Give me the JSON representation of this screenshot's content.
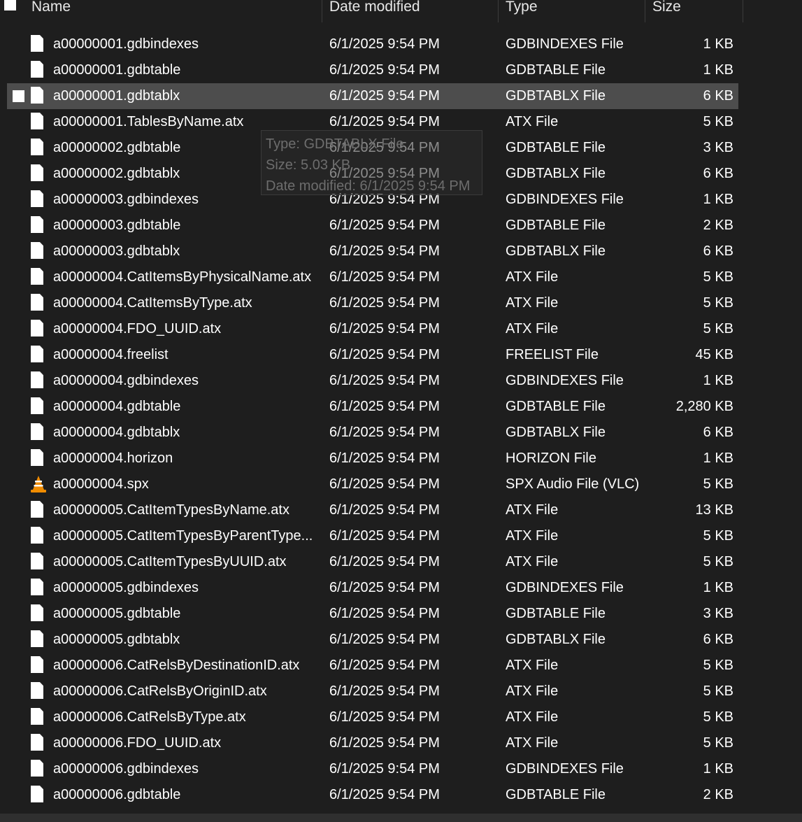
{
  "columns": {
    "name": "Name",
    "date": "Date modified",
    "type": "Type",
    "size": "Size"
  },
  "files": [
    {
      "name": "a00000001.gdbindexes",
      "date": "6/1/2025 9:54 PM",
      "type": "GDBINDEXES File",
      "size": "1 KB",
      "icon": "file-icon"
    },
    {
      "name": "a00000001.gdbtable",
      "date": "6/1/2025 9:54 PM",
      "type": "GDBTABLE File",
      "size": "1 KB",
      "icon": "file-icon"
    },
    {
      "name": "a00000001.gdbtablx",
      "date": "6/1/2025 9:54 PM",
      "type": "GDBTABLX File",
      "size": "6 KB",
      "icon": "file-icon",
      "selected": true
    },
    {
      "name": "a00000001.TablesByName.atx",
      "date": "6/1/2025 9:54 PM",
      "type": "ATX File",
      "size": "5 KB",
      "icon": "file-icon"
    },
    {
      "name": "a00000002.gdbtable",
      "date": "6/1/2025 9:54 PM",
      "type": "GDBTABLE File",
      "size": "3 KB",
      "icon": "file-icon"
    },
    {
      "name": "a00000002.gdbtablx",
      "date": "6/1/2025 9:54 PM",
      "type": "GDBTABLX File",
      "size": "6 KB",
      "icon": "file-icon"
    },
    {
      "name": "a00000003.gdbindexes",
      "date": "6/1/2025 9:54 PM",
      "type": "GDBINDEXES File",
      "size": "1 KB",
      "icon": "file-icon"
    },
    {
      "name": "a00000003.gdbtable",
      "date": "6/1/2025 9:54 PM",
      "type": "GDBTABLE File",
      "size": "2 KB",
      "icon": "file-icon"
    },
    {
      "name": "a00000003.gdbtablx",
      "date": "6/1/2025 9:54 PM",
      "type": "GDBTABLX File",
      "size": "6 KB",
      "icon": "file-icon"
    },
    {
      "name": "a00000004.CatItemsByPhysicalName.atx",
      "date": "6/1/2025 9:54 PM",
      "type": "ATX File",
      "size": "5 KB",
      "icon": "file-icon"
    },
    {
      "name": "a00000004.CatItemsByType.atx",
      "date": "6/1/2025 9:54 PM",
      "type": "ATX File",
      "size": "5 KB",
      "icon": "file-icon"
    },
    {
      "name": "a00000004.FDO_UUID.atx",
      "date": "6/1/2025 9:54 PM",
      "type": "ATX File",
      "size": "5 KB",
      "icon": "file-icon"
    },
    {
      "name": "a00000004.freelist",
      "date": "6/1/2025 9:54 PM",
      "type": "FREELIST File",
      "size": "45 KB",
      "icon": "file-icon"
    },
    {
      "name": "a00000004.gdbindexes",
      "date": "6/1/2025 9:54 PM",
      "type": "GDBINDEXES File",
      "size": "1 KB",
      "icon": "file-icon"
    },
    {
      "name": "a00000004.gdbtable",
      "date": "6/1/2025 9:54 PM",
      "type": "GDBTABLE File",
      "size": "2,280 KB",
      "icon": "file-icon"
    },
    {
      "name": "a00000004.gdbtablx",
      "date": "6/1/2025 9:54 PM",
      "type": "GDBTABLX File",
      "size": "6 KB",
      "icon": "file-icon"
    },
    {
      "name": "a00000004.horizon",
      "date": "6/1/2025 9:54 PM",
      "type": "HORIZON File",
      "size": "1 KB",
      "icon": "file-icon"
    },
    {
      "name": "a00000004.spx",
      "date": "6/1/2025 9:54 PM",
      "type": "SPX Audio File (VLC)",
      "size": "5 KB",
      "icon": "vlc-icon"
    },
    {
      "name": "a00000005.CatItemTypesByName.atx",
      "date": "6/1/2025 9:54 PM",
      "type": "ATX File",
      "size": "13 KB",
      "icon": "file-icon"
    },
    {
      "name": "a00000005.CatItemTypesByParentType...",
      "date": "6/1/2025 9:54 PM",
      "type": "ATX File",
      "size": "5 KB",
      "icon": "file-icon"
    },
    {
      "name": "a00000005.CatItemTypesByUUID.atx",
      "date": "6/1/2025 9:54 PM",
      "type": "ATX File",
      "size": "5 KB",
      "icon": "file-icon"
    },
    {
      "name": "a00000005.gdbindexes",
      "date": "6/1/2025 9:54 PM",
      "type": "GDBINDEXES File",
      "size": "1 KB",
      "icon": "file-icon"
    },
    {
      "name": "a00000005.gdbtable",
      "date": "6/1/2025 9:54 PM",
      "type": "GDBTABLE File",
      "size": "3 KB",
      "icon": "file-icon"
    },
    {
      "name": "a00000005.gdbtablx",
      "date": "6/1/2025 9:54 PM",
      "type": "GDBTABLX File",
      "size": "6 KB",
      "icon": "file-icon"
    },
    {
      "name": "a00000006.CatRelsByDestinationID.atx",
      "date": "6/1/2025 9:54 PM",
      "type": "ATX File",
      "size": "5 KB",
      "icon": "file-icon"
    },
    {
      "name": "a00000006.CatRelsByOriginID.atx",
      "date": "6/1/2025 9:54 PM",
      "type": "ATX File",
      "size": "5 KB",
      "icon": "file-icon"
    },
    {
      "name": "a00000006.CatRelsByType.atx",
      "date": "6/1/2025 9:54 PM",
      "type": "ATX File",
      "size": "5 KB",
      "icon": "file-icon"
    },
    {
      "name": "a00000006.FDO_UUID.atx",
      "date": "6/1/2025 9:54 PM",
      "type": "ATX File",
      "size": "5 KB",
      "icon": "file-icon"
    },
    {
      "name": "a00000006.gdbindexes",
      "date": "6/1/2025 9:54 PM",
      "type": "GDBINDEXES File",
      "size": "1 KB",
      "icon": "file-icon"
    },
    {
      "name": "a00000006.gdbtable",
      "date": "6/1/2025 9:54 PM",
      "type": "GDBTABLE File",
      "size": "2 KB",
      "icon": "file-icon"
    }
  ],
  "tooltip": {
    "type_line": "Type: GDBTABLX File",
    "size_line": "Size: 5.03 KB",
    "date_line": "Date modified: 6/1/2025 9:54 PM"
  },
  "colors": {
    "background": "#1e1e1e",
    "selected_row": "#4d4d4d",
    "text": "#ffffff",
    "vlc_orange": "#f08c00"
  }
}
